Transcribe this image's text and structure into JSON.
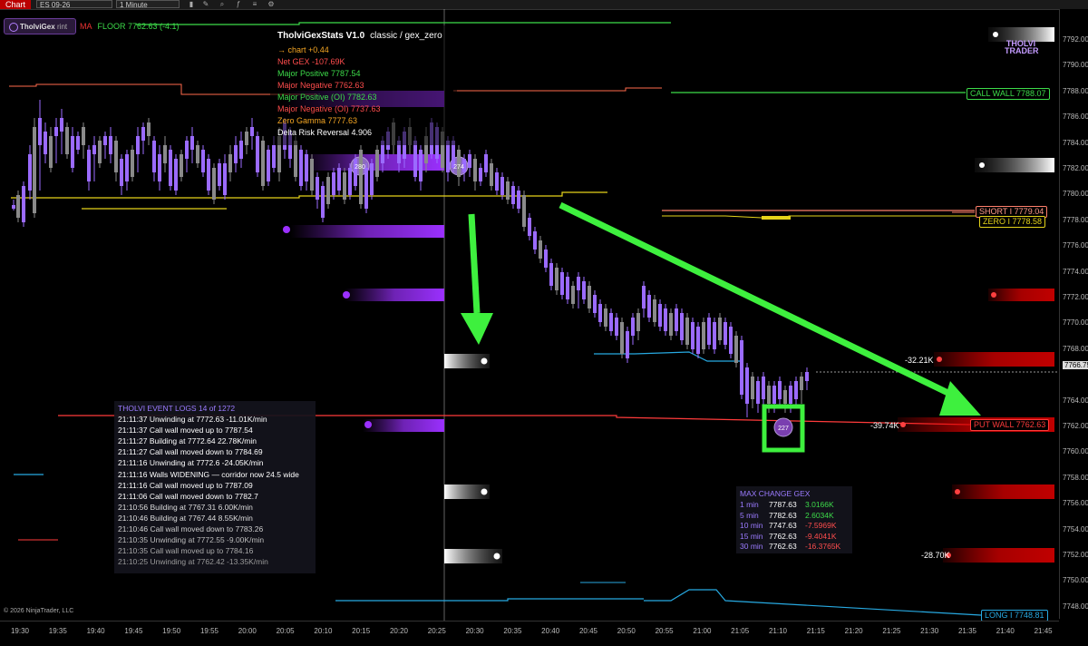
{
  "toolbar": {
    "chart_label": "Chart",
    "instrument": "ES 09-26",
    "timeframe": "1 Minute"
  },
  "indicator": {
    "badge_name": "TholviGex",
    "badge_extra": "rint",
    "ma_label": "MA",
    "floor_label": "FLOOR 7762.63 (-4.1)"
  },
  "stats_panel": {
    "title": "TholviGexStats V1.0",
    "subtitle": "classic / gex_zero",
    "rows": [
      {
        "text": "→ chart  +0.44",
        "color": "#f5a623"
      },
      {
        "text": "Net GEX   -107.69K",
        "color": "#ff4d4d"
      },
      {
        "text": "Major Positive   7787.54",
        "color": "#3ddc4a"
      },
      {
        "text": "Major Negative   7762.63",
        "color": "#ff4d4d"
      },
      {
        "text": "Major Positive (OI)   7782.63",
        "color": "#3ddc4a"
      },
      {
        "text": "Major Negative (OI)   7737.63",
        "color": "#ff4d4d"
      },
      {
        "text": "Zero Gamma   7777.63",
        "color": "#f5a623"
      },
      {
        "text": "Delta Risk Reversal   4.906",
        "color": "#ffffff"
      }
    ]
  },
  "event_log": {
    "header": "THOLVI EVENT LOGS   14 of 1272",
    "lines": [
      {
        "text": "21:11:37   Unwinding at 7772.63   -11.01K/min",
        "color": "#ffffff"
      },
      {
        "text": "21:11:37   Call wall moved up to 7787.54",
        "color": "#ffffff"
      },
      {
        "text": "21:11:27   Building at 7772.64   22.78K/min",
        "color": "#ffffff"
      },
      {
        "text": "21:11:27   Call wall moved down to 7784.69",
        "color": "#ffffff"
      },
      {
        "text": "21:11:16   Unwinding at 7772.6   -24.05K/min",
        "color": "#ffffff"
      },
      {
        "text": "21:11:16   Walls WIDENING — corridor now 24.5 wide",
        "color": "#ffffff"
      },
      {
        "text": "21:11:16   Call wall moved up to 7787.09",
        "color": "#ffffff"
      },
      {
        "text": "21:11:06   Call wall moved down to 7782.7",
        "color": "#ffffff"
      },
      {
        "text": "21:10:56   Building at 7767.31   6.00K/min",
        "color": "#dddddd"
      },
      {
        "text": "21:10:46   Building at 7767.44   8.55K/min",
        "color": "#dddddd"
      },
      {
        "text": "21:10:46   Call wall moved down to 7783.26",
        "color": "#cccccc"
      },
      {
        "text": "21:10:35   Unwinding at 7772.55   -9.00K/min",
        "color": "#bbbbbb"
      },
      {
        "text": "21:10:35   Call wall moved up to 7784.16",
        "color": "#aaaaaa"
      },
      {
        "text": "21:10:25   Unwinding at 7762.42   -13.35K/min",
        "color": "#999999"
      }
    ]
  },
  "max_change": {
    "header": "MAX CHANGE GEX",
    "rows": [
      {
        "period": "1 min",
        "level": "7787.63",
        "change": "3.0166K",
        "color": "#3ddc4a"
      },
      {
        "period": "5 min",
        "level": "7782.63",
        "change": "2.6034K",
        "color": "#3ddc4a"
      },
      {
        "period": "10 min",
        "level": "7747.63",
        "change": "-7.5969K",
        "color": "#ff4d4d"
      },
      {
        "period": "15 min",
        "level": "7762.63",
        "change": "-9.4041K",
        "color": "#ff4d4d"
      },
      {
        "period": "30 min",
        "level": "7762.63",
        "change": "-16.3765K",
        "color": "#ff4d4d"
      }
    ]
  },
  "right_labels": {
    "call_wall": "CALL WALL  7788.07",
    "short": "SHORT I  7779.04",
    "zero": "ZERO I  7778.58",
    "put_wall": "PUT WALL  7762.63",
    "long": "LONG I  7748.81",
    "current_price": "7766.75"
  },
  "value_labels": {
    "v1": "-32.21K",
    "v2": "-39.74K",
    "v3": "-28.70K"
  },
  "bubbles": {
    "b1": "280",
    "b2": "274",
    "b3": "227"
  },
  "logo_text": "THOLVI TRADER",
  "copyright": "© 2026 NinjaTrader, LLC",
  "price_axis": [
    "7792.00",
    "7790.00",
    "7788.00",
    "7786.00",
    "7784.00",
    "7782.00",
    "7780.00",
    "7778.00",
    "7776.00",
    "7774.00",
    "7772.00",
    "7770.00",
    "7768.00",
    "7766.75",
    "7764.00",
    "7762.00",
    "7760.00",
    "7758.00",
    "7756.00",
    "7754.00",
    "7752.00",
    "7750.00",
    "7748.00"
  ],
  "time_axis": [
    "19:30",
    "19:35",
    "19:40",
    "19:45",
    "19:50",
    "19:55",
    "20:00",
    "20:05",
    "20:10",
    "20:15",
    "20:20",
    "20:25",
    "20:30",
    "20:35",
    "20:40",
    "20:45",
    "20:50",
    "20:55",
    "21:00",
    "21:05",
    "21:10",
    "21:15",
    "21:20",
    "21:25",
    "21:30",
    "21:35",
    "21:40",
    "21:45"
  ],
  "colors": {
    "bull": "#9b6bff",
    "bear": "#8a8a8a",
    "call_wall": "#3ddc4a",
    "put_wall": "#ff3b3b",
    "zero": "#e5d41a",
    "long": "#27a9e1",
    "annotation": "#3ef03e"
  }
}
